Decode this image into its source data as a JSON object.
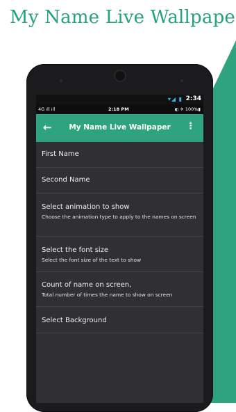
{
  "promo": {
    "title": "My Name Live Wallpaper"
  },
  "device_status": {
    "time": "2:34",
    "icons": "▾◢ ▮"
  },
  "phone_status": {
    "left": "4G ıll ıll",
    "time": "2:18 PM",
    "right": "◐ ✈ 100%▮"
  },
  "appbar": {
    "back_icon": "←",
    "title": "My Name Live Wallpaper",
    "menu_icon": "⋮"
  },
  "settings": [
    {
      "label": "First Name",
      "description": ""
    },
    {
      "label": "Second Name",
      "description": ""
    },
    {
      "label": "Select animation to show",
      "description": "Choose the animation type to apply to the names on screen"
    },
    {
      "label": "Select the font size",
      "description": "Select the font size of the text to show"
    },
    {
      "label": "Count of name on screen,",
      "description": "Total number of times the name to show on screen"
    },
    {
      "label": "Select Background",
      "description": ""
    }
  ],
  "colors": {
    "accent": "#2fa37d",
    "title_green": "#26a17e",
    "screen_bg": "#303032"
  }
}
